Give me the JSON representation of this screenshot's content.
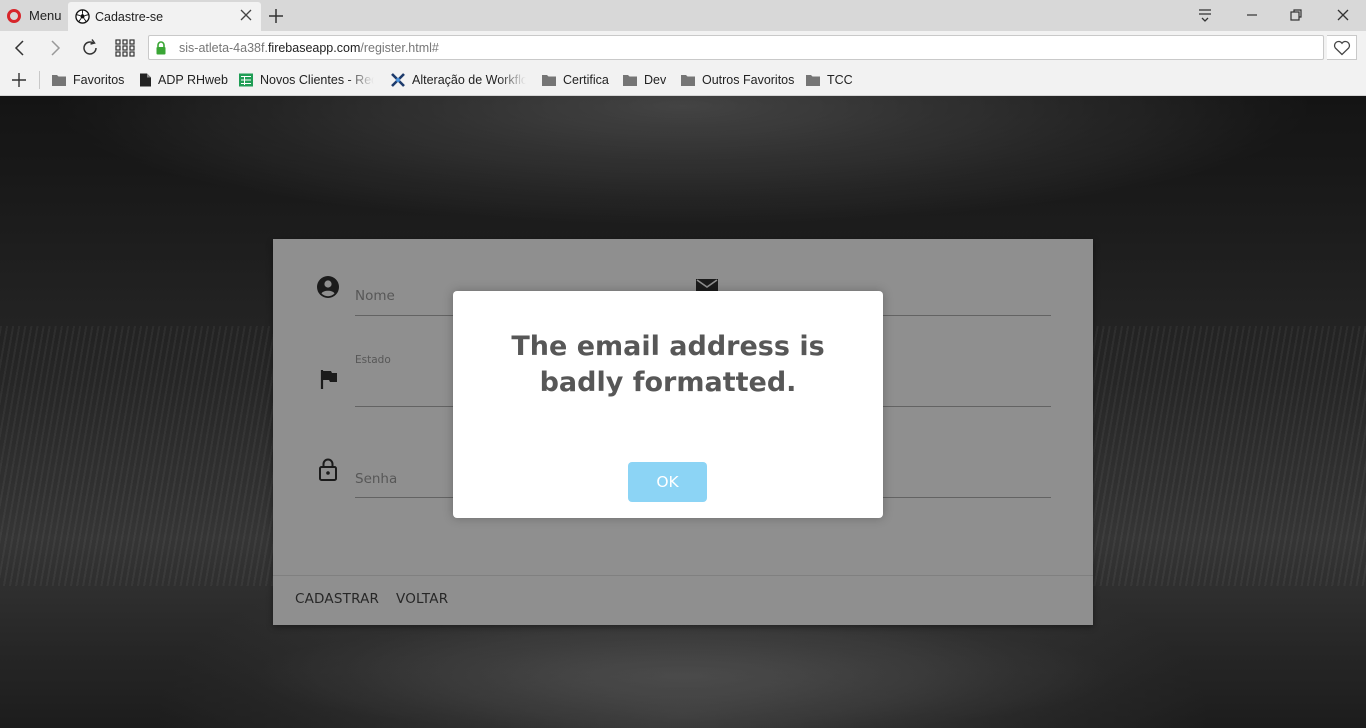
{
  "browser": {
    "menu_label": "Menu",
    "tab": {
      "title": "Cadastre-se"
    },
    "url": {
      "subdomain": "sis-atleta-4a38f.",
      "domain": "firebaseapp.com",
      "path": "/register.html#"
    },
    "bookmarks": [
      {
        "label": "Favoritos",
        "icon": "folder-icon"
      },
      {
        "label": "ADP RHweb",
        "icon": "document-icon"
      },
      {
        "label": "Novos Clientes - Rede",
        "icon": "spreadsheet-icon"
      },
      {
        "label": "Alteração de Workflow",
        "icon": "x-logo-icon"
      },
      {
        "label": "Certifica",
        "icon": "folder-icon"
      },
      {
        "label": "Dev",
        "icon": "folder-icon"
      },
      {
        "label": "Outros Favoritos",
        "icon": "folder-icon"
      },
      {
        "label": "TCC",
        "icon": "folder-icon"
      }
    ]
  },
  "form": {
    "nome_label": "Nome",
    "estado_label": "Estado",
    "senha_label": "Senha",
    "icons": [
      "account-circle-icon",
      "mail-icon",
      "flag-icon",
      "lock-icon"
    ],
    "cadastrar_label": "CADASTRAR",
    "voltar_label": "VOLTAR"
  },
  "dialog": {
    "message": "The email address is badly formatted.",
    "ok_label": "OK",
    "ok_color": "#8cd4f5"
  },
  "colors": {
    "brand_red": "#d7262b",
    "card_bg": "#9c9c9c"
  }
}
